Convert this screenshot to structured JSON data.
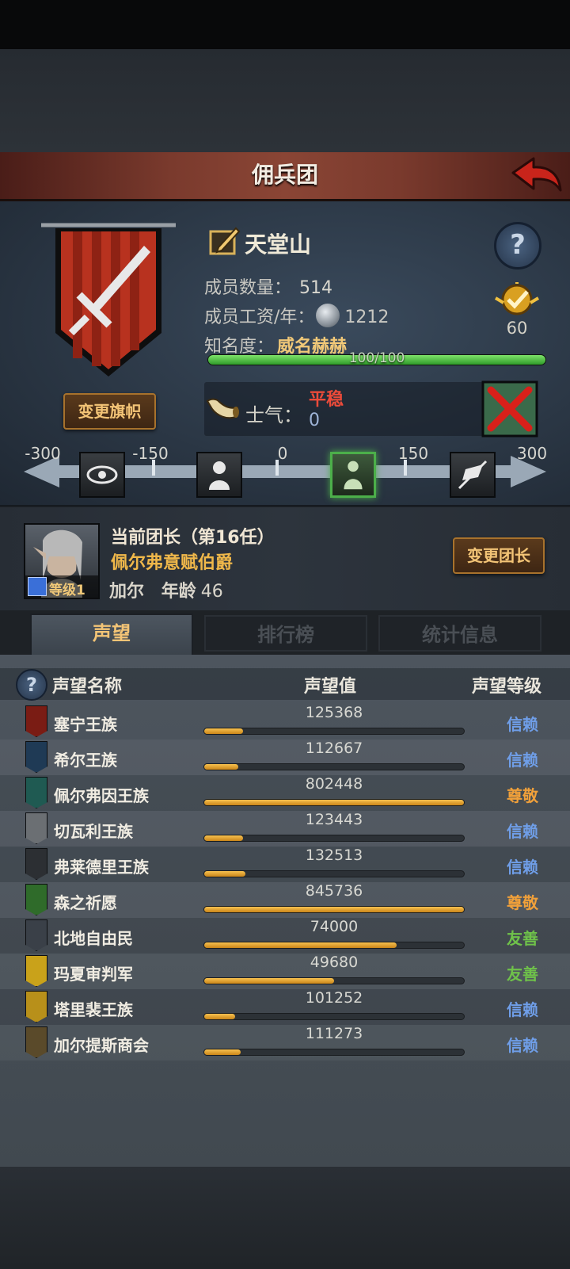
{
  "header": {
    "title": "佣兵团"
  },
  "guild": {
    "name": "天堂山",
    "members_label": "成员数量：",
    "members_value": "514",
    "salary_label": "成员工资/年：",
    "salary_value": "1212",
    "fame_label": "知名度：",
    "fame_value": "威名赫赫",
    "fame_progress_text": "100/100",
    "fame_progress": 1.0,
    "rank_value": "60",
    "change_flag_label": "变更旗帜",
    "help": "?"
  },
  "morale": {
    "label": "士气：",
    "state": "平稳",
    "value": "0",
    "scale": [
      "-300",
      "-150",
      "0",
      "150",
      "300"
    ]
  },
  "leader": {
    "title": "当前团长（第16任）",
    "name": "佩尔弗意赋伯爵",
    "short_name": "加尔",
    "age_label": "年龄",
    "age_value": "46",
    "level_text": "等级1",
    "change_leader_label": "变更团长"
  },
  "tabs": [
    {
      "label": "声望"
    },
    {
      "label": "排行榜"
    },
    {
      "label": "统计信息"
    }
  ],
  "reputation": {
    "help": "?",
    "col_name": "声望名称",
    "col_value": "声望值",
    "col_level": "声望等级",
    "rows": [
      {
        "name": "塞宁王族",
        "value": "125368",
        "progress": 0.15,
        "level": "信赖",
        "level_color": "#6f9ee8",
        "icon_color": "#7a1c14"
      },
      {
        "name": "希尔王族",
        "value": "112667",
        "progress": 0.13,
        "level": "信赖",
        "level_color": "#6f9ee8",
        "icon_color": "#1f3a55"
      },
      {
        "name": "佩尔弗因王族",
        "value": "802448",
        "progress": 1.0,
        "level": "尊敬",
        "level_color": "#f0a03a",
        "icon_color": "#1f5a52"
      },
      {
        "name": "切瓦利王族",
        "value": "123443",
        "progress": 0.15,
        "level": "信赖",
        "level_color": "#6f9ee8",
        "icon_color": "#6b6f73"
      },
      {
        "name": "弗莱德里王族",
        "value": "132513",
        "progress": 0.16,
        "level": "信赖",
        "level_color": "#6f9ee8",
        "icon_color": "#2c2f33"
      },
      {
        "name": "森之祈愿",
        "value": "845736",
        "progress": 1.0,
        "level": "尊敬",
        "level_color": "#f0a03a",
        "icon_color": "#2f6b2a"
      },
      {
        "name": "北地自由民",
        "value": "74000",
        "progress": 0.74,
        "level": "友善",
        "level_color": "#6fc24a",
        "icon_color": "#3a4048"
      },
      {
        "name": "玛夏审判军",
        "value": "49680",
        "progress": 0.5,
        "level": "友善",
        "level_color": "#6fc24a",
        "icon_color": "#c9a21a"
      },
      {
        "name": "塔里裴王族",
        "value": "101252",
        "progress": 0.12,
        "level": "信赖",
        "level_color": "#6f9ee8",
        "icon_color": "#b8901a"
      },
      {
        "name": "加尔提斯商会",
        "value": "111273",
        "progress": 0.14,
        "level": "信赖",
        "level_color": "#6f9ee8",
        "icon_color": "#5a4a2a"
      }
    ]
  }
}
